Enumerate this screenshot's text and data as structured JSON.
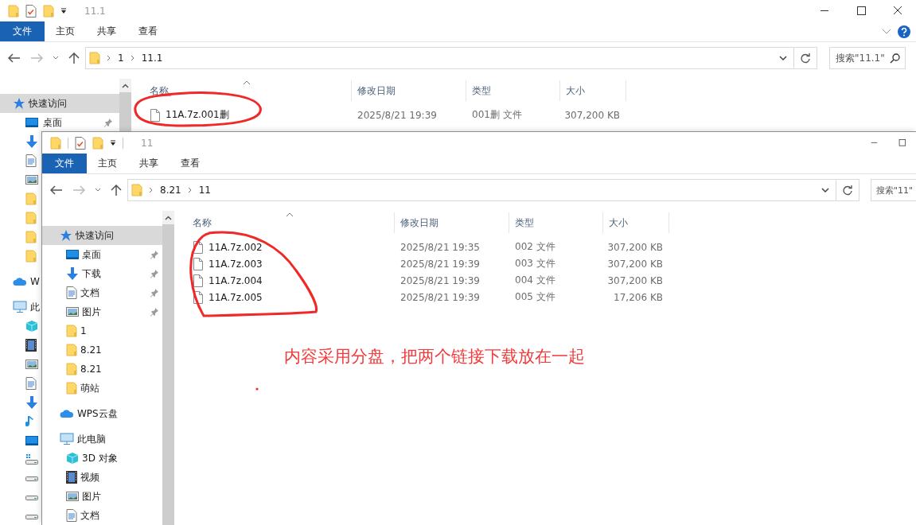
{
  "windows": [
    {
      "title": "11.1",
      "ribbon_tabs": [
        {
          "label": "文件",
          "selected": true
        },
        {
          "label": "主页",
          "selected": false
        },
        {
          "label": "共享",
          "selected": false
        },
        {
          "label": "查看",
          "selected": false
        }
      ],
      "breadcrumb": [
        "1",
        "11.1"
      ],
      "search": {
        "placeholder": "搜索\"11.1\""
      },
      "sidebar": [
        {
          "kind": "star",
          "label": "快速访问",
          "selected": true,
          "children": [
            {
              "kind": "desktop",
              "label": "桌面",
              "pinned": true,
              "selected": false
            },
            {
              "kind": "download",
              "selected": false
            },
            {
              "kind": "document",
              "selected": false
            },
            {
              "kind": "picture",
              "selected": false
            },
            {
              "kind": "folder",
              "selected": false
            },
            {
              "kind": "folder",
              "selected": false
            },
            {
              "kind": "folder",
              "selected": false
            },
            {
              "kind": "folder",
              "selected": false
            }
          ]
        },
        {
          "kind": "cloud",
          "label": "W",
          "selected": false
        },
        {
          "kind": "computer",
          "label": "此",
          "selected": false,
          "children": [
            {
              "kind": "cube",
              "selected": false
            },
            {
              "kind": "video",
              "selected": false
            },
            {
              "kind": "picture",
              "selected": false
            },
            {
              "kind": "document",
              "selected": false
            },
            {
              "kind": "download",
              "selected": false
            },
            {
              "kind": "music",
              "selected": false
            },
            {
              "kind": "desktop",
              "selected": false
            },
            {
              "kind": "system-drive",
              "selected": false
            },
            {
              "kind": "drive",
              "selected": false
            },
            {
              "kind": "drive",
              "selected": false
            },
            {
              "kind": "drive",
              "selected": false
            }
          ]
        }
      ],
      "columns": [
        "名称",
        "修改日期",
        "类型",
        "大小"
      ],
      "files": [
        {
          "name": "11A.7z.001删",
          "date": "2025/8/21 19:39",
          "type": "001删 文件",
          "size": "307,200 KB"
        }
      ]
    },
    {
      "title": "11",
      "ribbon_tabs": [
        {
          "label": "文件",
          "selected": true
        },
        {
          "label": "主页",
          "selected": false
        },
        {
          "label": "共享",
          "selected": false
        },
        {
          "label": "查看",
          "selected": false
        }
      ],
      "breadcrumb": [
        "8.21",
        "11"
      ],
      "search": {
        "placeholder": "搜索\"11\""
      },
      "sidebar": [
        {
          "kind": "star",
          "label": "快速访问",
          "selected": true,
          "children": [
            {
              "kind": "desktop",
              "label": "桌面",
              "pinned": true,
              "selected": false
            },
            {
              "kind": "download",
              "label": "下载",
              "pinned": true,
              "selected": false
            },
            {
              "kind": "document",
              "label": "文档",
              "pinned": true,
              "selected": false
            },
            {
              "kind": "picture",
              "label": "图片",
              "pinned": true,
              "selected": false
            },
            {
              "kind": "folder",
              "label": "1",
              "pinned": false,
              "selected": false
            },
            {
              "kind": "folder",
              "label": "8.21",
              "pinned": false,
              "selected": false
            },
            {
              "kind": "folder",
              "label": "8.21",
              "pinned": false,
              "selected": false
            },
            {
              "kind": "folder",
              "label": "萌站",
              "pinned": false,
              "selected": false
            }
          ]
        },
        {
          "kind": "cloud",
          "label": "WPS云盘",
          "selected": false
        },
        {
          "kind": "computer",
          "label": "此电脑",
          "selected": false,
          "children": [
            {
              "kind": "cube",
              "label": "3D 对象",
              "pinned": false,
              "selected": false
            },
            {
              "kind": "video",
              "label": "视频",
              "pinned": false,
              "selected": false
            },
            {
              "kind": "picture",
              "label": "图片",
              "pinned": false,
              "selected": false
            },
            {
              "kind": "document",
              "label": "文档",
              "pinned": false,
              "selected": false
            }
          ]
        }
      ],
      "columns": [
        "名称",
        "修改日期",
        "类型",
        "大小"
      ],
      "files": [
        {
          "name": "11A.7z.002",
          "date": "2025/8/21 19:35",
          "type": "002 文件",
          "size": "307,200 KB"
        },
        {
          "name": "11A.7z.003",
          "date": "2025/8/21 19:39",
          "type": "003 文件",
          "size": "307,200 KB"
        },
        {
          "name": "11A.7z.004",
          "date": "2025/8/21 19:39",
          "type": "004 文件",
          "size": "307,200 KB"
        },
        {
          "name": "11A.7z.005",
          "date": "2025/8/21 19:39",
          "type": "005 文件",
          "size": "17,206 KB"
        }
      ]
    }
  ],
  "annotation": {
    "text": "内容采用分盘，把两个链接下载放在一起"
  }
}
